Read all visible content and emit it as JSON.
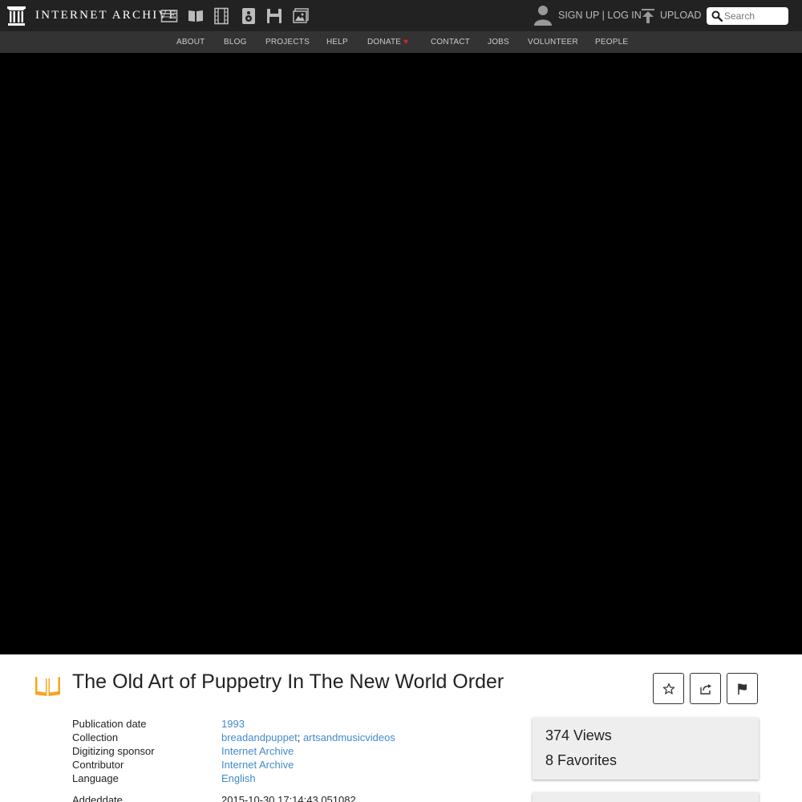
{
  "header": {
    "logo_text": "INTERNET ARCHIVE",
    "media_icons": [
      "web-icon",
      "texts-icon",
      "video-icon",
      "audio-icon",
      "software-icon",
      "images-icon"
    ],
    "sign_up": "SIGN UP",
    "separator": "|",
    "log_in": "LOG IN",
    "upload": "UPLOAD",
    "search_placeholder": "Search"
  },
  "nav": {
    "items": [
      "ABOUT",
      "BLOG",
      "PROJECTS",
      "HELP",
      "DONATE",
      "CONTACT",
      "JOBS",
      "VOLUNTEER",
      "PEOPLE"
    ]
  },
  "item": {
    "title": "The Old Art of Puppetry In The New World Order",
    "media_type_icon": "book-icon",
    "actions": [
      "favorite-icon",
      "share-icon",
      "flag-icon"
    ]
  },
  "metadata": {
    "publication_date": {
      "label": "Publication date",
      "value": "1993"
    },
    "collection": {
      "label": "Collection",
      "values": [
        "breadandpuppet",
        "artsandmusicvideos"
      ],
      "separator": ";"
    },
    "digitizing_sponsor": {
      "label": "Digitizing sponsor",
      "value": "Internet Archive"
    },
    "contributor": {
      "label": "Contributor",
      "value": "Internet Archive"
    },
    "language": {
      "label": "Language",
      "value": "English"
    },
    "addeddate_partial": {
      "label": "Addeddate",
      "value": "2015-10-30 17:14:43.051082"
    }
  },
  "stats": {
    "views": "374 Views",
    "favorites": "8 Favorites"
  },
  "colors": {
    "topbar": "#222222",
    "navbar": "#333333",
    "link": "#428bca",
    "book_icon": "#f8a41d",
    "heart": "#e3201b"
  }
}
